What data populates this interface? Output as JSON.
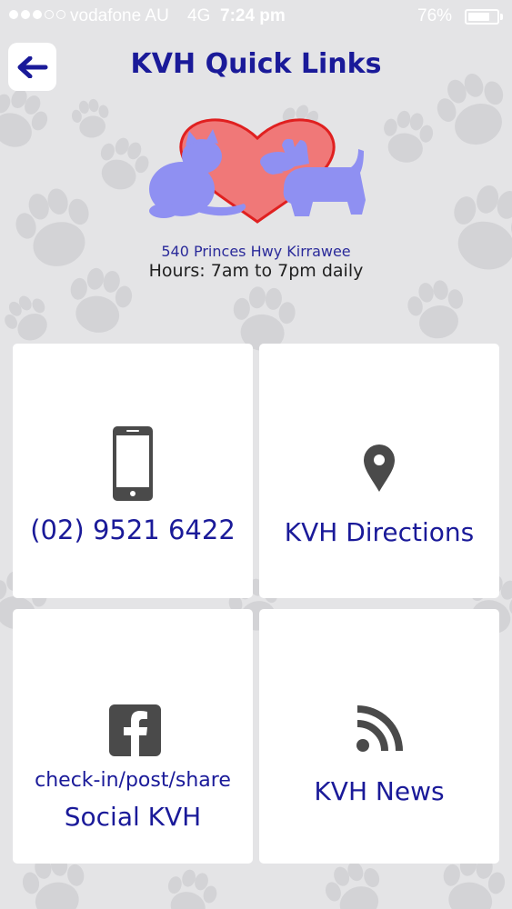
{
  "status_bar": {
    "carrier": "vodafone AU",
    "network": "4G",
    "time": "7:24 pm",
    "battery_percent": "76%",
    "battery_level": 0.76,
    "signal_bars_filled": 3,
    "signal_bars_total": 5
  },
  "header": {
    "title": "KVH Quick Links",
    "back_icon": "arrow-left-icon"
  },
  "clinic": {
    "address": "540 Princes Hwy Kirrawee",
    "hours": "Hours: 7am to 7pm daily"
  },
  "tiles": [
    {
      "icon": "smartphone-icon",
      "label": "(02) 9521 6422"
    },
    {
      "icon": "map-pin-icon",
      "label": "KVH Directions"
    },
    {
      "icon": "facebook-icon",
      "sublabel": "check-in/post/share",
      "label": "Social KVH"
    },
    {
      "icon": "rss-icon",
      "label": "KVH News"
    }
  ],
  "colors": {
    "title_blue": "#1a1a99",
    "background": "#e4e4e6",
    "tile_background": "#ffffff",
    "icon_gray": "#4a4a4a",
    "logo_heart": "#f07878",
    "logo_pets": "#8f90f2"
  }
}
